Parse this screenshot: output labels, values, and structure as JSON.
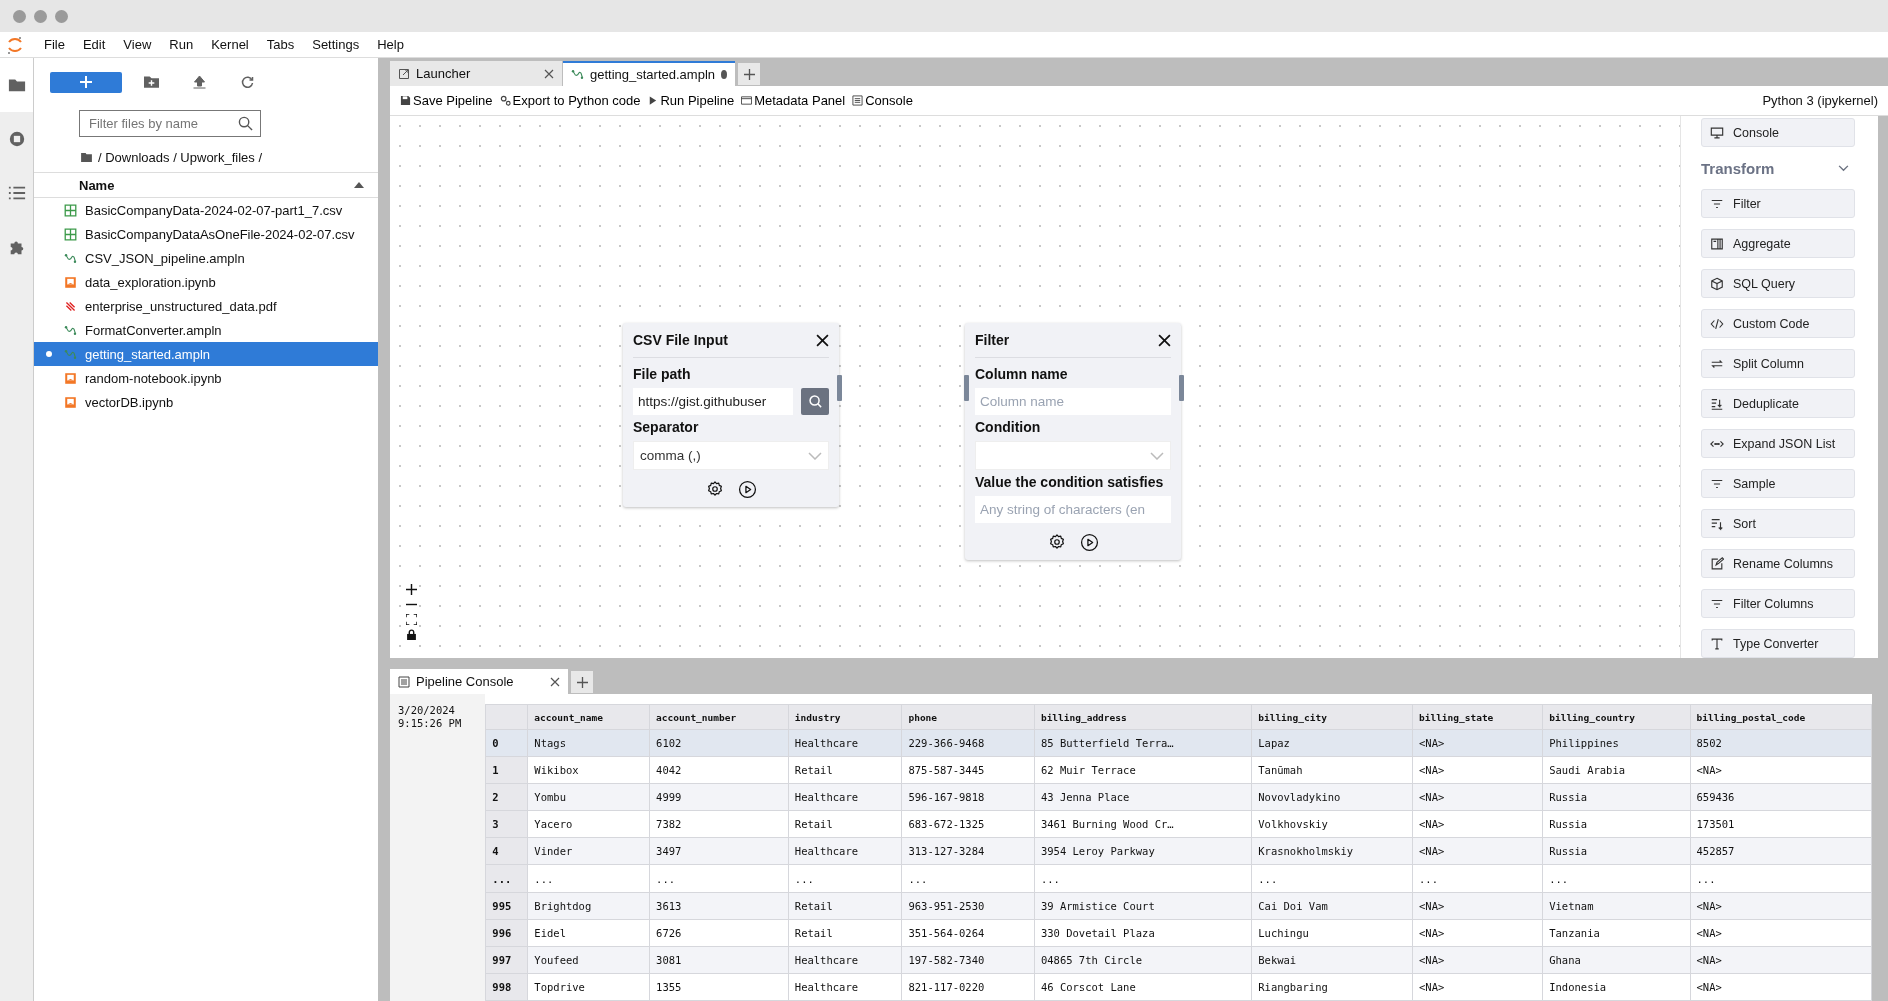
{
  "menu": [
    "File",
    "Edit",
    "View",
    "Run",
    "Kernel",
    "Tabs",
    "Settings",
    "Help"
  ],
  "sidebar": {
    "filter": {
      "placeholder": "Filter files by name"
    },
    "breadcrumb": "/ Downloads / Upwork_files /",
    "column": "Name",
    "files": [
      {
        "name": "BasicCompanyData-2024-02-07-part1_7.csv",
        "kind": "csv",
        "selected": false,
        "open": false
      },
      {
        "name": "BasicCompanyDataAsOneFile-2024-02-07.csv",
        "kind": "csv",
        "selected": false,
        "open": false
      },
      {
        "name": "CSV_JSON_pipeline.ampln",
        "kind": "pipeline",
        "selected": false,
        "open": false
      },
      {
        "name": "data_exploration.ipynb",
        "kind": "notebook",
        "selected": false,
        "open": false
      },
      {
        "name": "enterprise_unstructured_data.pdf",
        "kind": "pdf",
        "selected": false,
        "open": false
      },
      {
        "name": "FormatConverter.ampln",
        "kind": "pipeline",
        "selected": false,
        "open": false
      },
      {
        "name": "getting_started.ampln",
        "kind": "pipeline",
        "selected": true,
        "open": true
      },
      {
        "name": "random-notebook.ipynb",
        "kind": "notebook",
        "selected": false,
        "open": false
      },
      {
        "name": "vectorDB.ipynb",
        "kind": "notebook",
        "selected": false,
        "open": false
      }
    ]
  },
  "tabs": [
    {
      "label": "Launcher",
      "kind": "launcher",
      "selected": false,
      "dirty": false
    },
    {
      "label": "getting_started.ampln",
      "kind": "pipeline",
      "selected": true,
      "dirty": true
    }
  ],
  "toolbar": {
    "buttons": [
      {
        "label": "Save Pipeline",
        "kind": "save"
      },
      {
        "label": "Export to Python code",
        "kind": "export"
      },
      {
        "label": "Run Pipeline",
        "kind": "run"
      },
      {
        "label": "Metadata Panel",
        "kind": "panel"
      },
      {
        "label": "Console",
        "kind": "console"
      }
    ],
    "kernel": "Python 3 (ipykernel)"
  },
  "nodes": [
    {
      "title": "CSV File Input",
      "input_handle": false,
      "output_handle": true,
      "fields": [
        {
          "kind": "file",
          "label": "File path",
          "value": "https://gist.githubuser"
        },
        {
          "kind": "select",
          "label": "Separator",
          "value": "comma (,)"
        }
      ]
    },
    {
      "title": "Filter",
      "input_handle": true,
      "output_handle": true,
      "fields": [
        {
          "kind": "text",
          "label": "Column name",
          "placeholder": "Column name"
        },
        {
          "kind": "select",
          "label": "Condition"
        },
        {
          "kind": "text",
          "label": "Value the condition satisfies",
          "placeholder": "Any string of characters (en"
        }
      ]
    }
  ],
  "palette": {
    "top_item": {
      "label": "Console",
      "kind": "console"
    },
    "section": "Transform",
    "expanded": true,
    "items": [
      {
        "label": "Filter",
        "kind": "filter"
      },
      {
        "label": "Aggregate",
        "kind": "aggregate"
      },
      {
        "label": "SQL Query",
        "kind": "cube"
      },
      {
        "label": "Custom Code",
        "kind": "code"
      },
      {
        "label": "Split Column",
        "kind": "split"
      },
      {
        "label": "Deduplicate",
        "kind": "dedup"
      },
      {
        "label": "Expand JSON List",
        "kind": "expand"
      },
      {
        "label": "Sample",
        "kind": "filter"
      },
      {
        "label": "Sort",
        "kind": "sort"
      },
      {
        "label": "Rename Columns",
        "kind": "rename"
      },
      {
        "label": "Filter Columns",
        "kind": "filter"
      },
      {
        "label": "Type Converter",
        "kind": "type"
      }
    ]
  },
  "console": {
    "tab": "Pipeline Console",
    "date": "3/20/2024",
    "time": "9:15:26 PM",
    "table": {
      "columns": [
        "account_name",
        "account_number",
        "industry",
        "phone",
        "billing_address",
        "billing_city",
        "billing_state",
        "billing_country",
        "billing_postal_code"
      ],
      "rows": [
        {
          "index": "0",
          "selected": true,
          "cells": [
            "Ntags",
            "6102",
            "Healthcare",
            "229-366-9468",
            "85 Butterfield Terra…",
            "Lapaz",
            "<NA>",
            "Philippines",
            "8502"
          ]
        },
        {
          "index": "1",
          "selected": false,
          "cells": [
            "Wikibox",
            "4042",
            "Retail",
            "875-587-3445",
            "62 Muir Terrace",
            "Tanūmah",
            "<NA>",
            "Saudi Arabia",
            "<NA>"
          ]
        },
        {
          "index": "2",
          "selected": false,
          "cells": [
            "Yombu",
            "4999",
            "Healthcare",
            "596-167-9818",
            "43 Jenna Place",
            "Novovladykino",
            "<NA>",
            "Russia",
            "659436"
          ]
        },
        {
          "index": "3",
          "selected": false,
          "cells": [
            "Yacero",
            "7382",
            "Retail",
            "683-672-1325",
            "3461 Burning Wood Cr…",
            "Volkhovskiy",
            "<NA>",
            "Russia",
            "173501"
          ]
        },
        {
          "index": "4",
          "selected": false,
          "cells": [
            "Vinder",
            "3497",
            "Healthcare",
            "313-127-3284",
            "3954 Leroy Parkway",
            "Krasnokholmskiy",
            "<NA>",
            "Russia",
            "452857"
          ]
        },
        {
          "index": "...",
          "selected": false,
          "cells": [
            "...",
            "...",
            "...",
            "...",
            "...",
            "...",
            "...",
            "...",
            "..."
          ]
        },
        {
          "index": "995",
          "selected": false,
          "cells": [
            "Brightdog",
            "3613",
            "Retail",
            "963-951-2530",
            "39 Armistice Court",
            "Cai Doi Vam",
            "<NA>",
            "Vietnam",
            "<NA>"
          ]
        },
        {
          "index": "996",
          "selected": false,
          "cells": [
            "Eidel",
            "6726",
            "Retail",
            "351-564-0264",
            "330 Dovetail Plaza",
            "Luchingu",
            "<NA>",
            "Tanzania",
            "<NA>"
          ]
        },
        {
          "index": "997",
          "selected": false,
          "cells": [
            "Youfeed",
            "3081",
            "Healthcare",
            "197-582-7340",
            "04865 7th Circle",
            "Bekwai",
            "<NA>",
            "Ghana",
            "<NA>"
          ]
        },
        {
          "index": "998",
          "selected": false,
          "cells": [
            "Topdrive",
            "1355",
            "Healthcare",
            "821-117-0220",
            "46 Corscot Lane",
            "Riangbaring",
            "<NA>",
            "Indonesia",
            "<NA>"
          ]
        }
      ]
    }
  }
}
